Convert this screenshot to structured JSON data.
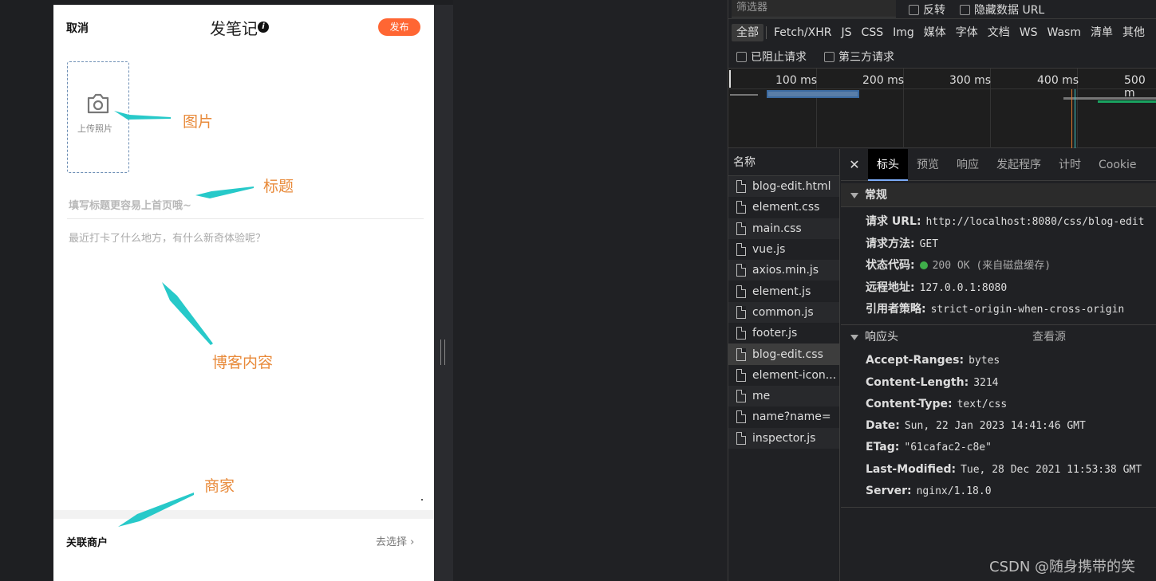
{
  "phone": {
    "cancel": "取消",
    "title": "发笔记",
    "info_icon": "i",
    "publish": "发布",
    "upload_label": "上传照片",
    "title_placeholder": "填写标题更容易上首页哦~",
    "content_placeholder": "最近打卡了什么地方，有什么新奇体验呢？",
    "merchant_label": "关联商户",
    "choose_label": "去选择 ›"
  },
  "annotations": {
    "image": "图片",
    "title": "标题",
    "content": "博客内容",
    "merchant": "商家"
  },
  "devtools": {
    "filter_placeholder": "筛选器",
    "invert": "反转",
    "hide_data_urls": "隐藏数据 URL",
    "types": [
      "全部",
      "Fetch/XHR",
      "JS",
      "CSS",
      "Img",
      "媒体",
      "字体",
      "文档",
      "WS",
      "Wasm",
      "清单",
      "其他"
    ],
    "blocked_requests": "已阻止请求",
    "third_party": "第三方请求",
    "timeline_labels": [
      "100 ms",
      "200 ms",
      "300 ms",
      "400 ms",
      "500 m"
    ],
    "names_header": "名称",
    "files": [
      "blog-edit.html",
      "element.css",
      "main.css",
      "vue.js",
      "axios.min.js",
      "element.js",
      "common.js",
      "footer.js",
      "blog-edit.css",
      "element-icon...",
      "me",
      "name?name=",
      "inspector.js"
    ],
    "tabs": [
      "标头",
      "预览",
      "响应",
      "发起程序",
      "计时",
      "Cookie"
    ],
    "close": "✕",
    "general_title": "常规",
    "general": [
      {
        "k": "请求 URL:",
        "v": "http://localhost:8080/css/blog-edit"
      },
      {
        "k": "请求方法:",
        "v": "GET"
      },
      {
        "k": "状态代码:",
        "v": "200 OK (来自磁盘缓存)"
      },
      {
        "k": "远程地址:",
        "v": "127.0.0.1:8080"
      },
      {
        "k": "引用者策略:",
        "v": "strict-origin-when-cross-origin"
      }
    ],
    "response_headers_title": "响应头",
    "view_source": "查看源",
    "response_headers": [
      {
        "k": "Accept-Ranges:",
        "v": "bytes"
      },
      {
        "k": "Content-Length:",
        "v": "3214"
      },
      {
        "k": "Content-Type:",
        "v": "text/css"
      },
      {
        "k": "Date:",
        "v": "Sun, 22 Jan 2023 14:41:46 GMT"
      },
      {
        "k": "ETag:",
        "v": "\"61cafac2-c8e\""
      },
      {
        "k": "Last-Modified:",
        "v": "Tue, 28 Dec 2021 11:53:38 GMT"
      },
      {
        "k": "Server:",
        "v": "nginx/1.18.0"
      }
    ]
  },
  "watermark": "CSDN @随身携带的笑",
  "colors": {
    "accent": "#ff6633",
    "annotation": "#e88a3a",
    "arrow": "#27c9c9"
  }
}
